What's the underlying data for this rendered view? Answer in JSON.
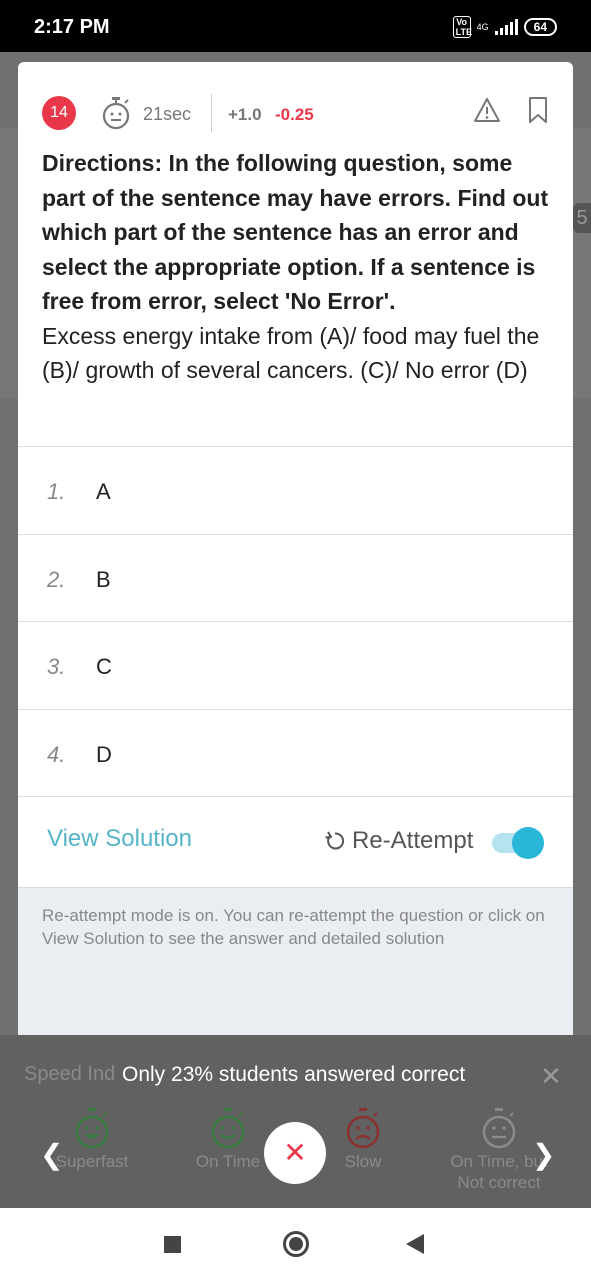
{
  "status_bar": {
    "time": "2:17 PM",
    "volte": "Vo LTE",
    "network": "4G",
    "battery": "64"
  },
  "background": {
    "side_number": "5"
  },
  "question_card": {
    "number": "14",
    "timer": "21sec",
    "positive_mark": "+1.0",
    "negative_mark": "-0.25",
    "directions": "Directions: In the following question, some part of the sentence may have errors. Find out which part of the sentence has an error and select the appropriate option. If a sentence is free from error, select 'No Error'.",
    "question": "Excess energy intake from (A)/ food may fuel the (B)/ growth of several cancers. (C)/ No error (D)",
    "options": [
      {
        "num": "1.",
        "label": "A"
      },
      {
        "num": "2.",
        "label": "B"
      },
      {
        "num": "3.",
        "label": "C"
      },
      {
        "num": "4.",
        "label": "D"
      }
    ],
    "view_solution": "View Solution",
    "reattempt": "Re-Attempt",
    "reattempt_on": true,
    "info": "Re-attempt mode is on. You can re-attempt the question or click on View Solution to see the answer and detailed solution"
  },
  "bottom_panel": {
    "speed_title": "Speed Ind",
    "toast": "Only 23% students answered correct",
    "speeds": [
      {
        "label": "Superfast",
        "icon": "happy-timer-icon"
      },
      {
        "label": "On Time",
        "icon": "smile-timer-icon"
      },
      {
        "label": "Slow",
        "icon": "sad-timer-icon"
      },
      {
        "label": "On Time, but Not correct",
        "icon": "neutral-timer-icon"
      }
    ]
  },
  "colors": {
    "accent_red": "#e8384a",
    "accent_teal": "#56b4c8",
    "toggle_blue": "#29b6d8",
    "speed_green": "#3a7d44"
  }
}
